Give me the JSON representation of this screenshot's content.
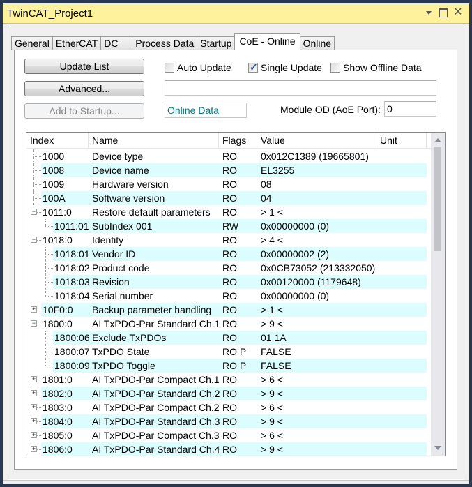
{
  "window": {
    "title": "TwinCAT_Project1",
    "controls": [
      "dropdown-icon",
      "maximize-icon",
      "close-icon"
    ],
    "close_glyph": "✕"
  },
  "tabs": [
    {
      "label": "General",
      "active": false
    },
    {
      "label": "EtherCAT",
      "active": false
    },
    {
      "label": "DC",
      "active": false
    },
    {
      "label": "Process Data",
      "active": false
    },
    {
      "label": "Startup",
      "active": false
    },
    {
      "label": "CoE - Online",
      "active": true
    },
    {
      "label": "Online",
      "active": false
    }
  ],
  "toolbar": {
    "update_list": "Update List",
    "advanced": "Advanced...",
    "add_to_startup": "Add to Startup...",
    "auto_update": {
      "label": "Auto Update",
      "checked": false
    },
    "single_update": {
      "label": "Single Update",
      "checked": true
    },
    "show_offline": {
      "label": "Show Offline Data",
      "checked": false
    },
    "status_field": "",
    "online_data": "Online Data",
    "module_od_label": "Module OD (AoE Port):",
    "module_od_value": "0"
  },
  "grid": {
    "columns": [
      "Index",
      "Name",
      "Flags",
      "Value",
      "Unit"
    ],
    "rows": [
      {
        "index": "1000",
        "name": "Device type",
        "flags": "RO",
        "value": "0x012C1389 (19665801)",
        "unit": "",
        "level": 0,
        "expander": "none"
      },
      {
        "index": "1008",
        "name": "Device name",
        "flags": "RO",
        "value": "EL3255",
        "unit": "",
        "level": 0,
        "expander": "none"
      },
      {
        "index": "1009",
        "name": "Hardware version",
        "flags": "RO",
        "value": "08",
        "unit": "",
        "level": 0,
        "expander": "none"
      },
      {
        "index": "100A",
        "name": "Software version",
        "flags": "RO",
        "value": "04",
        "unit": "",
        "level": 0,
        "expander": "none"
      },
      {
        "index": "1011:0",
        "name": "Restore default parameters",
        "flags": "RO",
        "value": "> 1 <",
        "unit": "",
        "level": 0,
        "expander": "minus"
      },
      {
        "index": "1011:01",
        "name": "SubIndex 001",
        "flags": "RW",
        "value": "0x00000000 (0)",
        "unit": "",
        "level": 1,
        "expander": "none"
      },
      {
        "index": "1018:0",
        "name": "Identity",
        "flags": "RO",
        "value": "> 4 <",
        "unit": "",
        "level": 0,
        "expander": "minus"
      },
      {
        "index": "1018:01",
        "name": "Vendor ID",
        "flags": "RO",
        "value": "0x00000002 (2)",
        "unit": "",
        "level": 1,
        "expander": "none"
      },
      {
        "index": "1018:02",
        "name": "Product code",
        "flags": "RO",
        "value": "0x0CB73052 (213332050)",
        "unit": "",
        "level": 1,
        "expander": "none"
      },
      {
        "index": "1018:03",
        "name": "Revision",
        "flags": "RO",
        "value": "0x00120000 (1179648)",
        "unit": "",
        "level": 1,
        "expander": "none"
      },
      {
        "index": "1018:04",
        "name": "Serial number",
        "flags": "RO",
        "value": "0x00000000 (0)",
        "unit": "",
        "level": 1,
        "expander": "none"
      },
      {
        "index": "10F0:0",
        "name": "Backup parameter handling",
        "flags": "RO",
        "value": "> 1 <",
        "unit": "",
        "level": 0,
        "expander": "plus"
      },
      {
        "index": "1800:0",
        "name": "AI TxPDO-Par Standard Ch.1",
        "flags": "RO",
        "value": "> 9 <",
        "unit": "",
        "level": 0,
        "expander": "minus"
      },
      {
        "index": "1800:06",
        "name": "Exclude TxPDOs",
        "flags": "RO",
        "value": "01 1A",
        "unit": "",
        "level": 1,
        "expander": "none"
      },
      {
        "index": "1800:07",
        "name": "TxPDO State",
        "flags": "RO P",
        "value": "FALSE",
        "unit": "",
        "level": 1,
        "expander": "none"
      },
      {
        "index": "1800:09",
        "name": "TxPDO Toggle",
        "flags": "RO P",
        "value": "FALSE",
        "unit": "",
        "level": 1,
        "expander": "none"
      },
      {
        "index": "1801:0",
        "name": "AI TxPDO-Par Compact Ch.1",
        "flags": "RO",
        "value": "> 6 <",
        "unit": "",
        "level": 0,
        "expander": "plus"
      },
      {
        "index": "1802:0",
        "name": "AI TxPDO-Par Standard Ch.2",
        "flags": "RO",
        "value": "> 9 <",
        "unit": "",
        "level": 0,
        "expander": "plus"
      },
      {
        "index": "1803:0",
        "name": "AI TxPDO-Par Compact Ch.2",
        "flags": "RO",
        "value": "> 6 <",
        "unit": "",
        "level": 0,
        "expander": "plus"
      },
      {
        "index": "1804:0",
        "name": "AI TxPDO-Par Standard Ch.3",
        "flags": "RO",
        "value": "> 9 <",
        "unit": "",
        "level": 0,
        "expander": "plus"
      },
      {
        "index": "1805:0",
        "name": "AI TxPDO-Par Compact Ch.3",
        "flags": "RO",
        "value": "> 6 <",
        "unit": "",
        "level": 0,
        "expander": "plus"
      },
      {
        "index": "1806:0",
        "name": "AI TxPDO-Par Standard Ch.4",
        "flags": "RO",
        "value": "> 9 <",
        "unit": "",
        "level": 0,
        "expander": "plus"
      }
    ]
  },
  "colors": {
    "titlebar": "#fff29d",
    "alt_row": "#dcfdfd",
    "online_data_text": "#008080",
    "background": "#293955"
  }
}
